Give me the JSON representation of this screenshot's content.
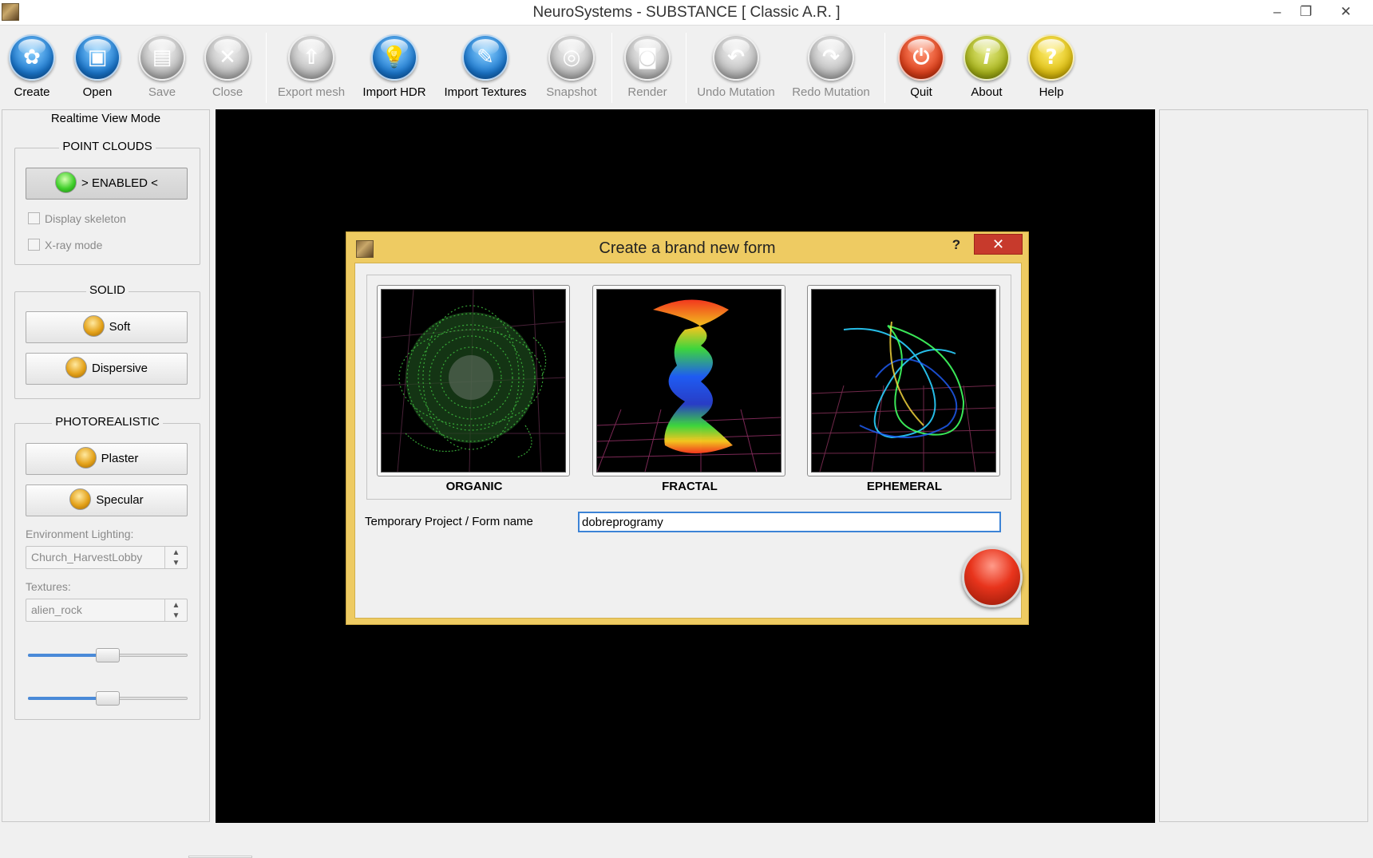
{
  "window": {
    "title": "NeuroSystems - SUBSTANCE  [ Classic A.R. ]",
    "minimize_glyph": "–",
    "restore_glyph": "❐",
    "close_glyph": "✕"
  },
  "toolbar": {
    "create": "Create",
    "open": "Open",
    "save": "Save",
    "close": "Close",
    "export_mesh": "Export mesh",
    "import_hdr": "Import HDR",
    "import_textures": "Import Textures",
    "snapshot": "Snapshot",
    "render": "Render",
    "undo_mutation": "Undo Mutation",
    "redo_mutation": "Redo Mutation",
    "quit": "Quit",
    "about": "About",
    "help": "Help",
    "disabled_items": [
      "Save",
      "Close",
      "Export mesh",
      "Snapshot",
      "Render",
      "Undo Mutation",
      "Redo Mutation"
    ]
  },
  "left_panel": {
    "title": "Realtime View Mode",
    "point_clouds": {
      "title": "POINT CLOUDS",
      "enabled_button": "> ENABLED <",
      "display_skeleton": "Display skeleton",
      "xray_mode": "X-ray mode"
    },
    "solid": {
      "title": "SOLID",
      "soft": "Soft",
      "dispersive": "Dispersive"
    },
    "photorealistic": {
      "title": "PHOTOREALISTIC",
      "plaster": "Plaster",
      "specular": "Specular",
      "env_lighting_label": "Environment Lighting:",
      "env_lighting_value": "Church_HarvestLobby",
      "textures_label": "Textures:",
      "textures_value": "alien_rock",
      "slider1_level": 0.5,
      "slider2_level": 0.5
    }
  },
  "dialog": {
    "title": "Create a brand new form",
    "help_glyph": "?",
    "close_glyph": "✕",
    "choices": [
      {
        "label": "ORGANIC"
      },
      {
        "label": "FRACTAL"
      },
      {
        "label": "EPHEMERAL"
      }
    ],
    "name_label": "Temporary Project / Form name",
    "name_value": "dobreprogramy"
  },
  "colors": {
    "dialog_frame": "#eecb62",
    "dialog_close": "#c73a2c",
    "accent_blue": "#3c83d6",
    "viewport": "#000000"
  }
}
